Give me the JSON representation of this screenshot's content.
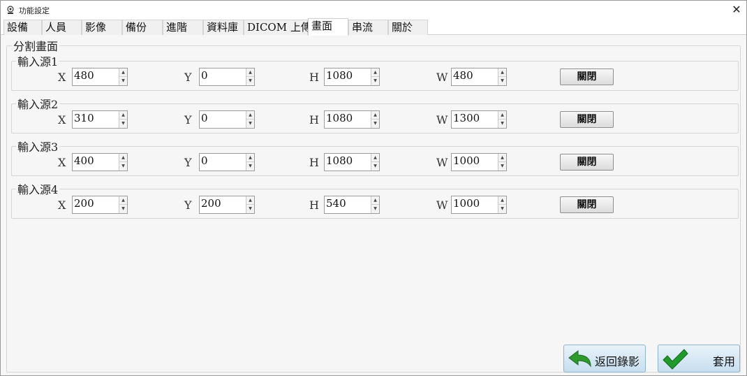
{
  "window": {
    "title": "功能設定",
    "close_glyph": "✕"
  },
  "tabs": [
    {
      "label": "設備",
      "active": false
    },
    {
      "label": "人員",
      "active": false
    },
    {
      "label": "影像",
      "active": false
    },
    {
      "label": "備份",
      "active": false
    },
    {
      "label": "進階",
      "active": false
    },
    {
      "label": "資料庫",
      "active": false
    },
    {
      "label": "DICOM 上傳",
      "active": false
    },
    {
      "label": "畫面",
      "active": true
    },
    {
      "label": "串流",
      "active": false
    },
    {
      "label": "關於",
      "active": false
    }
  ],
  "split_screen": {
    "legend": "分割畫面",
    "field_labels": {
      "x": "X",
      "y": "Y",
      "h": "H",
      "w": "W"
    },
    "sources": [
      {
        "label": "輸入源1",
        "x": "480",
        "y": "0",
        "h": "1080",
        "w": "480",
        "button": "關閉"
      },
      {
        "label": "輸入源2",
        "x": "310",
        "y": "0",
        "h": "1080",
        "w": "1300",
        "button": "關閉"
      },
      {
        "label": "輸入源3",
        "x": "400",
        "y": "0",
        "h": "1080",
        "w": "1000",
        "button": "關閉"
      },
      {
        "label": "輸入源4",
        "x": "200",
        "y": "200",
        "h": "540",
        "w": "1000",
        "button": "關閉"
      }
    ]
  },
  "footer": {
    "back_label": "返回錄影",
    "apply_label": "套用",
    "back_icon": "back-arrow-icon",
    "apply_icon": "checkmark-icon",
    "back_icon_color": "#2e9a2e",
    "apply_icon_color": "#1f9a2b"
  }
}
